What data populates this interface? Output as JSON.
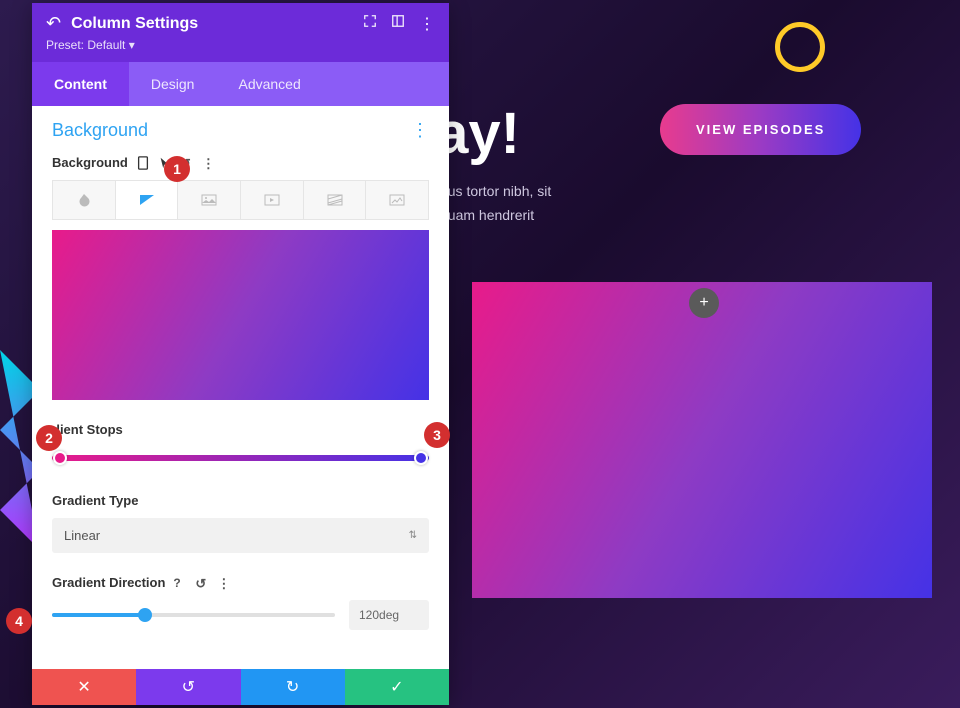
{
  "page": {
    "title_fragment": "lay!",
    "cta": "VIEW EPISODES",
    "para_line1": "rius tortor nibh, sit",
    "para_line2": "quam hendrerit"
  },
  "panel": {
    "title": "Column Settings",
    "preset": "Preset: Default ▾"
  },
  "tabs": {
    "content": "Content",
    "design": "Design",
    "advanced": "Advanced"
  },
  "section": {
    "title": "Background"
  },
  "labels": {
    "background": "Background",
    "gradient_stops": "dient Stops",
    "gradient_type": "Gradient Type",
    "gradient_direction": "Gradient Direction"
  },
  "gradient_type": {
    "value": "Linear"
  },
  "gradient_direction": {
    "value": "120deg"
  },
  "badges": {
    "b1": "1",
    "b2": "2",
    "b3": "3",
    "b4": "4"
  },
  "icons": {
    "close": "✕",
    "undo": "↺",
    "redo": "↻",
    "check": "✓",
    "plus": "+",
    "dots": "⋮",
    "caret": "⌃⌄",
    "help": "?",
    "more": "⋮"
  }
}
